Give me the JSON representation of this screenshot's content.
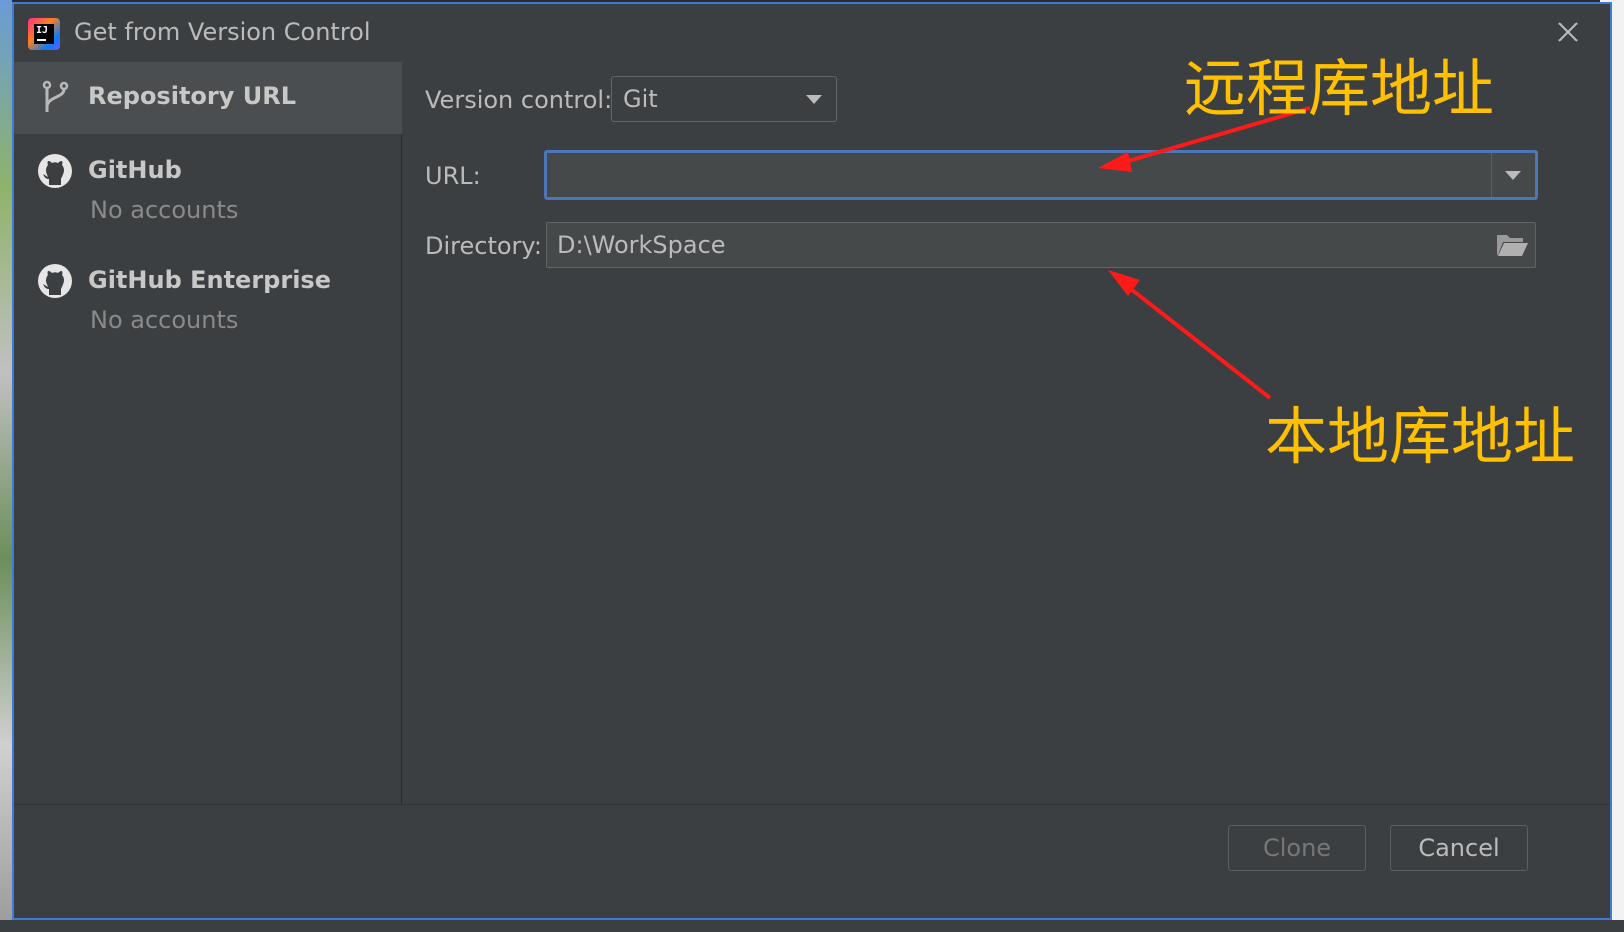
{
  "window": {
    "title": "Get from Version Control"
  },
  "sidebar": {
    "items": [
      {
        "label": "Repository URL",
        "icon": "branch-icon"
      },
      {
        "label": "GitHub",
        "sublabel": "No accounts",
        "icon": "github-icon"
      },
      {
        "label": "GitHub Enterprise",
        "sublabel": "No accounts",
        "icon": "github-icon"
      }
    ]
  },
  "form": {
    "version_control_label": "Version control:",
    "version_control_value": "Git",
    "url_label": "URL:",
    "url_value": "",
    "directory_label": "Directory:",
    "directory_value": "D:\\WorkSpace"
  },
  "annotations": {
    "remote": "远程库地址",
    "local": "本地库地址",
    "color": "#ffc000",
    "arrow_color": "#ff1a1a"
  },
  "footer": {
    "clone_label": "Clone",
    "cancel_label": "Cancel"
  },
  "theme": {
    "accent": "#3d7bd6",
    "background": "#3c3f41",
    "text": "#bbbbbb"
  }
}
